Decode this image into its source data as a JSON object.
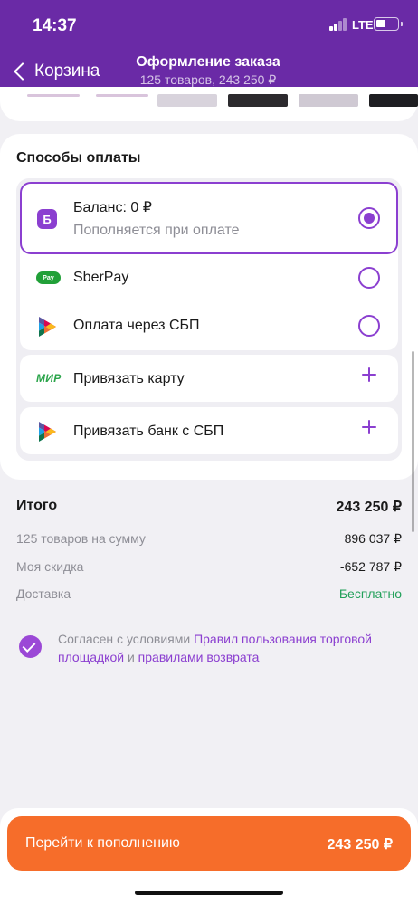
{
  "status_bar": {
    "time": "14:37",
    "network": "LTE"
  },
  "header": {
    "back_label": "Корзина",
    "title": "Оформление заказа",
    "subtitle": "125 товаров, 243 250 ₽"
  },
  "payment": {
    "section_title": "Способы оплаты",
    "methods": [
      {
        "label": "Баланс: 0 ₽",
        "sublabel": "Пополняется при оплате",
        "icon": "balance-icon",
        "icon_text": "Б",
        "selected": true
      },
      {
        "label": "SberPay",
        "icon": "sberpay-icon",
        "icon_text": "Pay",
        "selected": false
      },
      {
        "label": "Оплата через СБП",
        "icon": "sbp-icon",
        "selected": false
      }
    ],
    "add_options": [
      {
        "label": "Привязать карту",
        "icon": "mir-icon",
        "icon_text": "МИР"
      },
      {
        "label": "Привязать банк с СБП",
        "icon": "sbp-icon"
      }
    ]
  },
  "summary": {
    "total_label": "Итого",
    "total_value": "243 250 ₽",
    "rows": [
      {
        "label": "125 товаров на сумму",
        "value": "896 037 ₽"
      },
      {
        "label": "Моя скидка",
        "value": "-652 787 ₽"
      },
      {
        "label": "Доставка",
        "value": "Бесплатно"
      }
    ]
  },
  "agreement": {
    "checked": true,
    "prefix": "Согласен с условиями ",
    "link1": "Правил пользования торговой площадкой",
    "middle": " и ",
    "link2": "правилами возврата"
  },
  "cta": {
    "label": "Перейти к пополнению",
    "amount": "243 250 ₽"
  },
  "colors": {
    "header": "#6a2aa6",
    "accent": "#8b3fd0",
    "cta": "#f66d2a",
    "free": "#22a05a"
  }
}
